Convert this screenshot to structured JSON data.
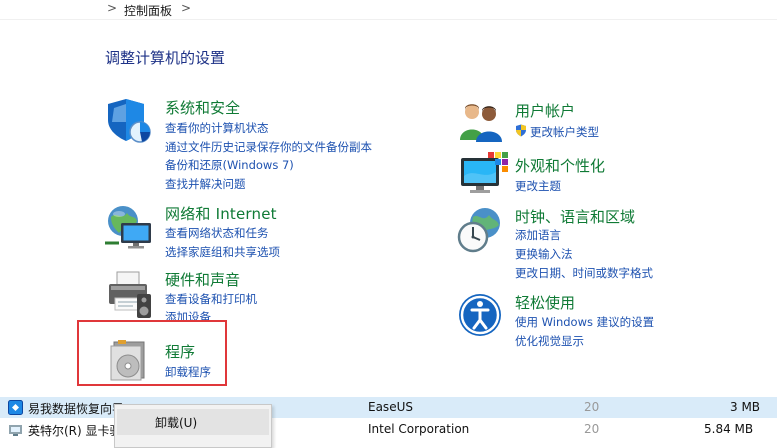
{
  "breadcrumb": {
    "separator": ">",
    "current": "控制面板"
  },
  "page_title": "调整计算机的设置",
  "left": {
    "system_security": {
      "title": "系统和安全",
      "links": [
        "查看你的计算机状态",
        "通过文件历史记录保存你的文件备份副本",
        "备份和还原(Windows 7)",
        "查找并解决问题"
      ]
    },
    "network": {
      "title": "网络和 Internet",
      "links": [
        "查看网络状态和任务",
        "选择家庭组和共享选项"
      ]
    },
    "hardware": {
      "title": "硬件和声音",
      "links": [
        "查看设备和打印机",
        "添加设备"
      ]
    },
    "programs": {
      "title": "程序",
      "links": [
        "卸载程序"
      ]
    }
  },
  "right": {
    "user_accounts": {
      "title": "用户帐户",
      "links": [
        "更改帐户类型"
      ]
    },
    "appearance": {
      "title": "外观和个性化",
      "links": [
        "更改主题"
      ]
    },
    "clock": {
      "title": "时钟、语言和区域",
      "links": [
        "添加语言",
        "更换输入法",
        "更改日期、时间或数字格式"
      ]
    },
    "ease": {
      "title": "轻松使用",
      "links": [
        "使用 Windows 建议的设置",
        "优化视觉显示"
      ]
    }
  },
  "program_list": [
    {
      "name": "易我数据恢复向导",
      "publisher": "EaseUS",
      "size": "3 MB",
      "date": "20",
      "selected": true
    },
    {
      "name": "英特尔(R) 显卡驱",
      "publisher": "Intel Corporation",
      "size": "5.84 MB",
      "date": "20",
      "selected": false
    }
  ],
  "context_menu": {
    "uninstall": "卸载(U)"
  },
  "colors": {
    "title_green": "#0f7a35",
    "link_blue": "#1e52b0",
    "heading_navy": "#1e3287",
    "highlight_red": "#e0373a"
  }
}
